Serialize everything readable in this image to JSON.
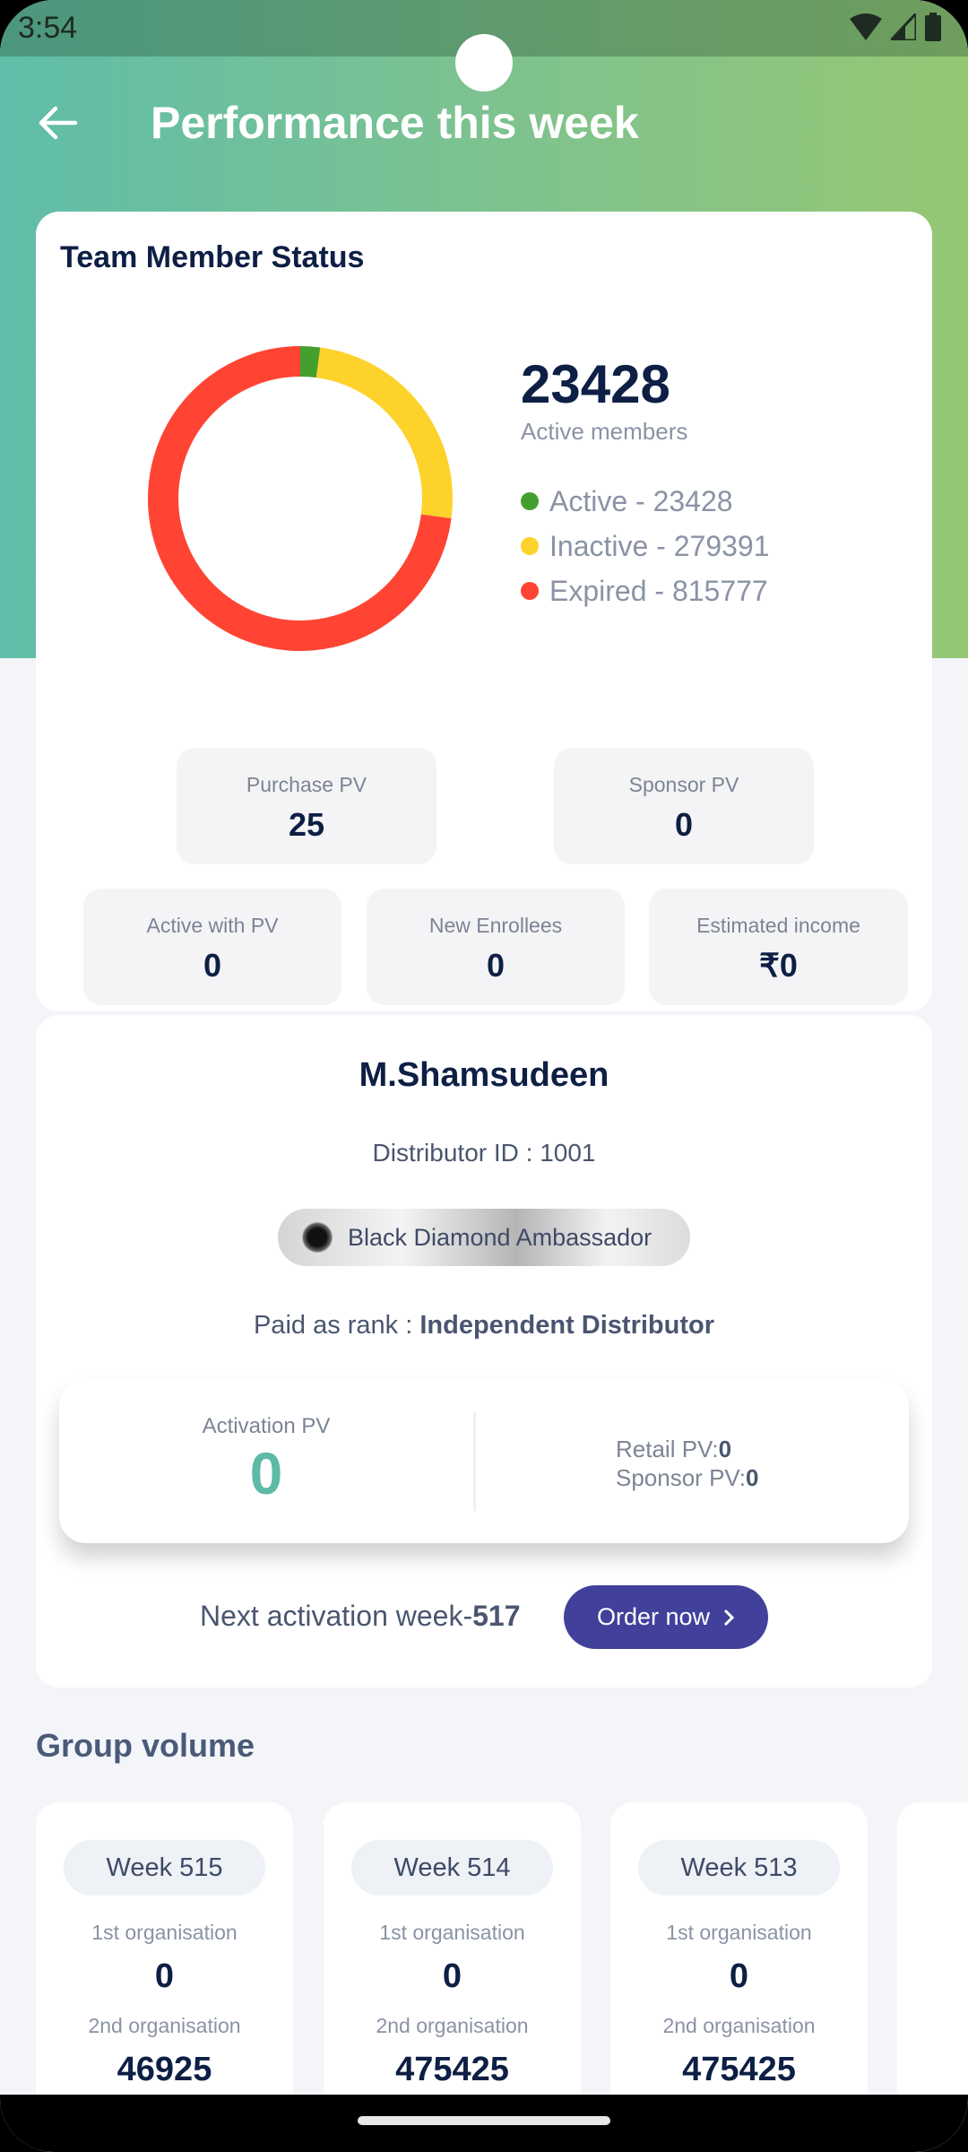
{
  "status_bar": {
    "time": "3:54"
  },
  "header": {
    "title": "Performance this week"
  },
  "team_status": {
    "title": "Team Member Status",
    "active_count": "23428",
    "active_label": "Active members",
    "legend": [
      {
        "label": "Active - 23428",
        "value": 23428,
        "color": "#43a02f"
      },
      {
        "label": "Inactive - 279391",
        "value": 279391,
        "color": "#fdd22a"
      },
      {
        "label": "Expired - 815777",
        "value": 815777,
        "color": "#ff4433"
      }
    ]
  },
  "stats": [
    {
      "label": "Purchase PV",
      "value": "25"
    },
    {
      "label": "Sponsor PV",
      "value": "0"
    },
    {
      "label": "Active with PV",
      "value": "0"
    },
    {
      "label": "New Enrollees",
      "value": "0"
    },
    {
      "label": "Estimated income",
      "value": "₹0"
    }
  ],
  "profile": {
    "name": "M.Shamsudeen",
    "distributor_id": "Distributor ID : 1001",
    "rank_badge": "Black Diamond Ambassador",
    "paid_as_label": "Paid as rank : ",
    "paid_as_value": "Independent Distributor",
    "activation_pv_label": "Activation PV",
    "activation_pv": "0",
    "retail_pv_label": "Retail PV:",
    "retail_pv": "0",
    "sponsor_pv_label": "Sponsor PV:",
    "sponsor_pv": "0",
    "next_activation_label": "Next activation week-",
    "next_activation_week": "517",
    "order_button": "Order now"
  },
  "group_volume": {
    "title": "Group volume",
    "weeks": [
      {
        "week": "Week 515",
        "first_label": "1st organisation",
        "first": "0",
        "second_label": "2nd organisation",
        "second": "46925"
      },
      {
        "week": "Week 514",
        "first_label": "1st organisation",
        "first": "0",
        "second_label": "2nd organisation",
        "second": "475425"
      },
      {
        "week": "Week 513",
        "first_label": "1st organisation",
        "first": "0",
        "second_label": "2nd organisation",
        "second": "475425"
      }
    ]
  }
}
